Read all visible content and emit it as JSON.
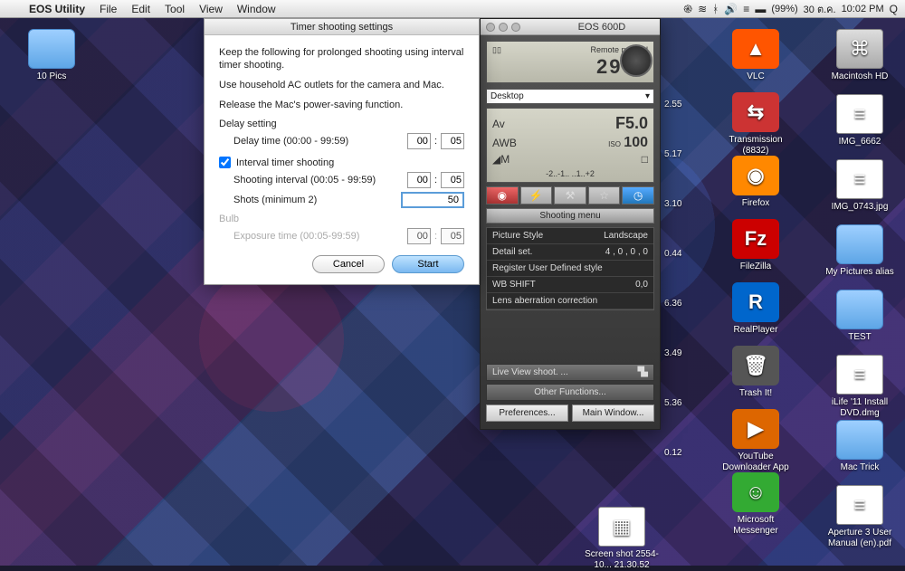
{
  "menubar": {
    "app_name": "EOS Utility",
    "items": [
      "File",
      "Edit",
      "Tool",
      "View",
      "Window"
    ],
    "right": {
      "flag": "≡",
      "battery": "(99%)",
      "date": "30 ต.ค.",
      "time": "10:02 PM",
      "search": "Q"
    }
  },
  "dialog": {
    "title": "Timer shooting settings",
    "intro1": "Keep the following for prolonged shooting using interval timer shooting.",
    "intro2": "Use household AC outlets for the camera and Mac.",
    "intro3": "Release the Mac's power-saving function.",
    "delay_label": "Delay setting",
    "delay_time_label": "Delay time (00:00 - 99:59)",
    "delay_mm": "00",
    "delay_ss": "05",
    "interval_check_label": "Interval timer shooting",
    "interval_label": "Shooting interval (00:05 - 99:59)",
    "interval_mm": "00",
    "interval_ss": "05",
    "shots_label": "Shots (minimum 2)",
    "shots_value": "50",
    "bulb_label": "Bulb",
    "exposure_label": "Exposure time (00:05-99:59)",
    "exposure_mm": "00",
    "exposure_ss": "05",
    "cancel": "Cancel",
    "start": "Start"
  },
  "camera": {
    "title": "EOS 600D",
    "remote_label": "Remote manual",
    "shots_remaining": "2904",
    "dest": "Desktop",
    "mode": "Av",
    "aperture": "F5.0",
    "wb": "AWB",
    "iso_label": "ISO",
    "iso": "100",
    "meter": "◢M",
    "drive": "□",
    "ev_scale": "-2..-1..  ..1..+2",
    "shooting_menu": "Shooting menu",
    "menu": [
      {
        "k": "Picture Style",
        "v": "Landscape"
      },
      {
        "k": "Detail set.",
        "v": "4 , 0 , 0 , 0"
      },
      {
        "k": "Register User Defined style",
        "v": ""
      },
      {
        "k": "WB SHIFT",
        "v": "0,0"
      },
      {
        "k": "Lens aberration correction",
        "v": ""
      }
    ],
    "live_view": "Live View shoot. ...",
    "other_fn": "Other Functions...",
    "prefs": "Preferences...",
    "main_window": "Main Window..."
  },
  "desktop": {
    "folder1": "10 Pics",
    "col_nums": [
      "2.55",
      "5.17",
      "3.10",
      "0.44",
      "6.36",
      "3.49",
      "5.36",
      "0.12"
    ],
    "apps": [
      {
        "name": "VLC",
        "glyph": "▲",
        "bg": "#f50"
      },
      {
        "name": "Transmission (8832)",
        "glyph": "⇆",
        "bg": "#c33"
      },
      {
        "name": "Firefox",
        "glyph": "◉",
        "bg": "#f80"
      },
      {
        "name": "FileZilla",
        "glyph": "Fz",
        "bg": "#c00"
      },
      {
        "name": "RealPlayer",
        "glyph": "R",
        "bg": "#06c"
      },
      {
        "name": "Trash It!",
        "glyph": "🗑",
        "bg": "#555"
      },
      {
        "name": "YouTube Downloader App",
        "glyph": "▶",
        "bg": "#d60"
      },
      {
        "name": "Microsoft Messenger",
        "glyph": "☺",
        "bg": "#3a3"
      }
    ],
    "files": [
      {
        "name": "Macintosh HD",
        "type": "hd"
      },
      {
        "name": "IMG_6662",
        "type": "file"
      },
      {
        "name": "IMG_0743.jpg",
        "type": "file"
      },
      {
        "name": "My Pictures alias",
        "type": "folder"
      },
      {
        "name": "TEST",
        "type": "folder"
      },
      {
        "name": "iLife '11 Install DVD.dmg",
        "type": "file"
      },
      {
        "name": "Mac Trick",
        "type": "folder"
      },
      {
        "name": "Aperture 3 User Manual (en).pdf",
        "type": "file"
      }
    ],
    "screenshot": "Screen shot 2554-10... 21.30.52"
  }
}
